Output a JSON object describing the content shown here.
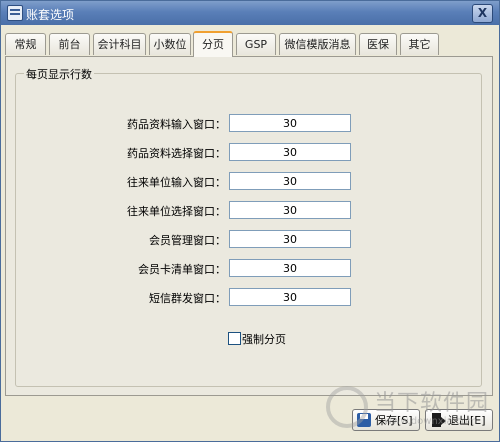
{
  "window": {
    "title": "账套选项",
    "close_label": "X"
  },
  "tabs": [
    {
      "label": "常规"
    },
    {
      "label": "前台"
    },
    {
      "label": "会计科目"
    },
    {
      "label": "小数位"
    },
    {
      "label": "分页"
    },
    {
      "label": "GSP"
    },
    {
      "label": "微信模版消息"
    },
    {
      "label": "医保"
    },
    {
      "label": "其它"
    }
  ],
  "active_tab": "分页",
  "group": {
    "title": "每页显示行数"
  },
  "fields": [
    {
      "label": "药品资料输入窗口：",
      "value": "30"
    },
    {
      "label": "药品资料选择窗口：",
      "value": "30"
    },
    {
      "label": "往来单位输入窗口：",
      "value": "30"
    },
    {
      "label": "往来单位选择窗口：",
      "value": "30"
    },
    {
      "label": "会员管理窗口：",
      "value": "30"
    },
    {
      "label": "会员卡清单窗口：",
      "value": "30"
    },
    {
      "label": "短信群发窗口：",
      "value": "30"
    }
  ],
  "force_paging": {
    "label": "强制分页",
    "checked": false
  },
  "buttons": {
    "save": "保存[S]",
    "exit": "退出[E]"
  },
  "icons": {
    "app": "app-icon",
    "save": "save-icon",
    "exit": "exit-icon"
  },
  "watermark": {
    "text": "当下软件园",
    "url": "www.downxia.com"
  },
  "colors": {
    "titlebar": "#5a7fb8",
    "active_tab_accent": "#f0a030",
    "window_bg": "#ece9d8"
  }
}
